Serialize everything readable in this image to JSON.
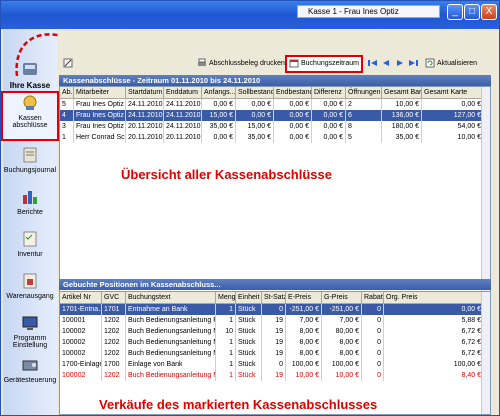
{
  "window": {
    "title": "Kasse 1 - Frau Ines Optiz",
    "btn_min": "_",
    "btn_max": "□",
    "btn_close": "X"
  },
  "sidebar": {
    "header": "Ihre Kasse",
    "items": [
      {
        "label": "Kassen abschlüsse",
        "icon": "cash-register-icon"
      },
      {
        "label": "Buchungsjournal",
        "icon": "journal-icon"
      },
      {
        "label": "Berichte",
        "icon": "report-chart-icon"
      },
      {
        "label": "Inventur",
        "icon": "inventory-icon"
      },
      {
        "label": "Warenausgang",
        "icon": "goods-out-icon"
      },
      {
        "label": "Programm Einstellung",
        "icon": "settings-monitor-icon"
      },
      {
        "label": "Gerätesteuerung",
        "icon": "device-control-icon"
      }
    ]
  },
  "toolbar": {
    "print_label": "Abschlussbeleg drucken",
    "period_label": "Buchungszeitraum",
    "refresh_label": "Aktualisieren"
  },
  "top_section": {
    "title": "Kassenabschlüsse - Zeitraum 01.11.2010 bis 24.11.2010",
    "columns": [
      "Ab...",
      "Mitarbeiter",
      "Startdatum",
      "Enddatum",
      "Anfangs...",
      "Sollbestand",
      "Endbestand",
      "Differenz",
      "Öffnungen",
      "Gesamt Bar",
      "Gesamt Karte"
    ],
    "rows": [
      [
        "5",
        "Frau Ines Optiz",
        "24.11.2010",
        "24.11.2010",
        "0,00 €",
        "0,00 €",
        "0,00 €",
        "0,00 €",
        "2",
        "10,00 €",
        "0,00 €"
      ],
      [
        "4",
        "Frau Ines Optiz",
        "24.11.2010",
        "24.11.2010",
        "15,00 €",
        "0,00 €",
        "0,00 €",
        "0,00 €",
        "6",
        "136,00 €",
        "127,00 €"
      ],
      [
        "3",
        "Frau Ines Optiz",
        "20.11.2010",
        "24.11.2010",
        "35,00 €",
        "15,00 €",
        "0,00 €",
        "0,00 €",
        "8",
        "180,00 €",
        "54,00 €"
      ],
      [
        "1",
        "Herr Conrad Sc...",
        "20.11.2010",
        "20.11.2010",
        "0,00 €",
        "35,00 €",
        "0,00 €",
        "0,00 €",
        "5",
        "35,00 €",
        "10,00 €"
      ]
    ],
    "selected_index": 1
  },
  "bottom_section": {
    "title": "Gebuchte Positionen im Kassenabschluss...",
    "columns": [
      "Artikel Nr",
      "GVC",
      "Buchungstext",
      "Menge",
      "Einheit",
      "St-Satz",
      "E-Preis",
      "G-Preis",
      "Rabatt",
      "Org. Preis"
    ],
    "rows": [
      [
        "1701-Entna...",
        "1701",
        "Entnahme an Bank",
        "1",
        "Stück",
        "0",
        "-251,00 €",
        "-251,00 €",
        "0",
        "0,00 €"
      ],
      [
        "100001",
        "1202",
        "Buch Bedienungsanleitung F",
        "1",
        "Stück",
        "19",
        "7,00 €",
        "7,00 €",
        "0",
        "5,88 €"
      ],
      [
        "100002",
        "1202",
        "Buch Bedienungsanleitung M",
        "10",
        "Stück",
        "19",
        "8,00 €",
        "80,00 €",
        "0",
        "6,72 €"
      ],
      [
        "100002",
        "1202",
        "Buch Bedienungsanleitung M",
        "1",
        "Stück",
        "19",
        "8,00 €",
        "8,00 €",
        "0",
        "6,72 €"
      ],
      [
        "100002",
        "1202",
        "Buch Bedienungsanleitung M",
        "1",
        "Stück",
        "19",
        "8,00 €",
        "8,00 €",
        "0",
        "6,72 €"
      ],
      [
        "1700-Einlage",
        "1700",
        "Einlage von Bank",
        "1",
        "Stück",
        "0",
        "100,00 €",
        "100,00 €",
        "0",
        "100,00 €"
      ],
      [
        "100002",
        "1202",
        "Buch Bedienungsanleitung M",
        "1",
        "Stück",
        "19",
        "10,00 €",
        "10,00 €",
        "0",
        "8,40 €"
      ]
    ],
    "selected_index": 0,
    "strike_index": 6
  },
  "annotations": {
    "top": "Übersicht aller Kassenabschlüsse",
    "bottom": "Verkäufe des markierten Kassenabschlusses"
  },
  "colors": {
    "accent": "#e00000",
    "selection": "#3a5aa8",
    "header": "#4a6cb3"
  }
}
